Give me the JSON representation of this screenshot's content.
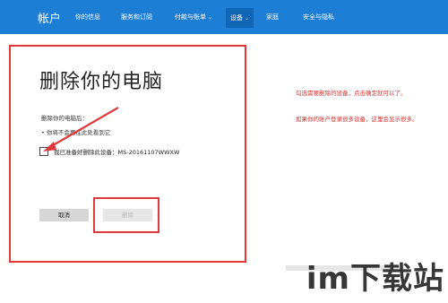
{
  "topbar": {
    "brand": "帐户",
    "items": [
      {
        "label": "你的信息"
      },
      {
        "label": "服务和订阅"
      },
      {
        "label": "付款与账单",
        "chevron": "⌄"
      },
      {
        "label": "设备",
        "chevron": "⌄",
        "active": true
      },
      {
        "label": "家庭"
      },
      {
        "label": "安全与隐私"
      }
    ],
    "color": "#1d7ed6"
  },
  "dialog": {
    "title": "删除你的电脑",
    "subtitle": "删除你的电脑后：",
    "bullet": "• 你将不会再在此处看到它",
    "checkbox_label": "我已准备好删除此设备：MS-20161107WWXW",
    "cancel_label": "取消",
    "delete_label": "删除"
  },
  "annotations": {
    "note1": "勾选需要删除的设备，点击确定就可以了。",
    "note2": "如果你的账户登录很多设备，这里会显示很多。",
    "highlight_color": "#e0393b"
  },
  "watermark": {
    "text": "im下载站"
  }
}
